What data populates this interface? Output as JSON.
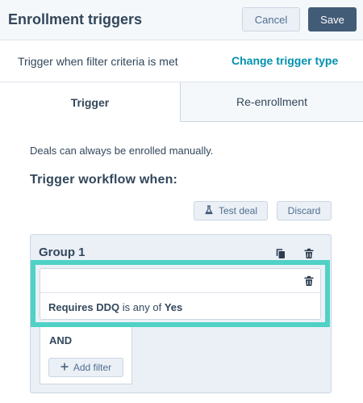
{
  "header": {
    "title": "Enrollment triggers",
    "cancel_label": "Cancel",
    "save_label": "Save"
  },
  "trigger_mode": {
    "text": "Trigger when filter criteria is met",
    "change_link": "Change trigger type"
  },
  "tabs": [
    {
      "label": "Trigger",
      "active": true
    },
    {
      "label": "Re-enrollment",
      "active": false
    }
  ],
  "manual_note": "Deals can always be enrolled manually.",
  "section_title": "Trigger workflow when:",
  "actions": {
    "test_label": "Test deal",
    "test_icon": "flask-icon",
    "discard_label": "Discard"
  },
  "group": {
    "title": "Group 1",
    "icons": [
      "copy-icon",
      "trash-icon"
    ],
    "filter": {
      "property": "Requires DDQ",
      "operator": "is any of",
      "value": "Yes"
    },
    "and_label": "AND",
    "add_filter_label": "Add filter"
  },
  "colors": {
    "accent_link": "#0091ae",
    "primary_button": "#425b76",
    "highlight": "#4fd1c5",
    "icon": "#2d3e50"
  }
}
